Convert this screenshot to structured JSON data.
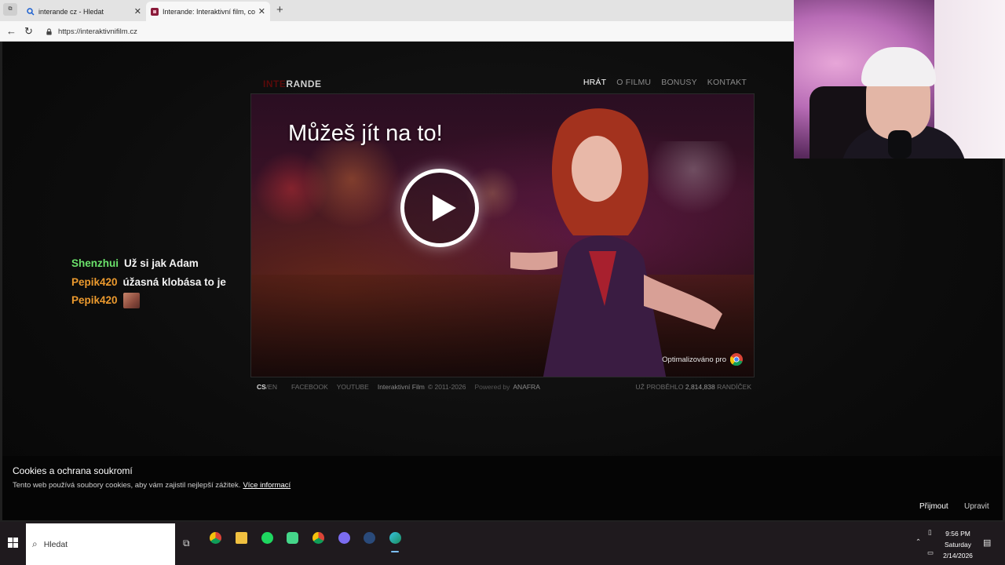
{
  "browser": {
    "tabs": [
      {
        "title": "interande cz - Hledat",
        "active": false
      },
      {
        "title": "Interande: Interaktivní film, co se d",
        "active": true
      }
    ],
    "url": "https://interaktivnifilm.cz"
  },
  "site": {
    "logo_a": "INTE",
    "logo_b": "RANDE",
    "nav": [
      "HRÁT",
      "O FILMU",
      "BONUSY",
      "KONTAKT"
    ],
    "hero_title": "Můžeš jít na to!",
    "optimized": "Optimalizováno pro",
    "footer": {
      "lang_cs": "CS",
      "lang_en": "/EN",
      "facebook": "FACEBOOK",
      "youtube": "YOUTUBE",
      "film": "Interaktivní Film",
      "copyright": "© 2011-2026",
      "powered": "Powered by",
      "anafra": "ANAFRA",
      "count_prefix": "UŽ PROBĚHLO",
      "count": "2,814,838",
      "count_suffix": "RANDÍČEK"
    }
  },
  "chat": [
    {
      "user": "Shenzhui",
      "message": "Už si jak Adam",
      "color": "#6be26b"
    },
    {
      "user": "Pepik420",
      "message": "úžasná klobása to je",
      "color": "#ec9a2e"
    },
    {
      "user": "Pepik420",
      "message": "",
      "emote": "emote-icon",
      "color": "#ec9a2e"
    }
  ],
  "cookie": {
    "title": "Cookies a ochrana soukromí",
    "text": "Tento web používá soubory cookies, aby vám zajistil nejlepší zážitek.",
    "link": "Více informací",
    "accept": "Přijmout",
    "edit": "Upravit"
  },
  "taskbar": {
    "search_placeholder": "Hledat",
    "time": "9:56 PM",
    "day": "Saturday",
    "date": "2/14/2026"
  }
}
